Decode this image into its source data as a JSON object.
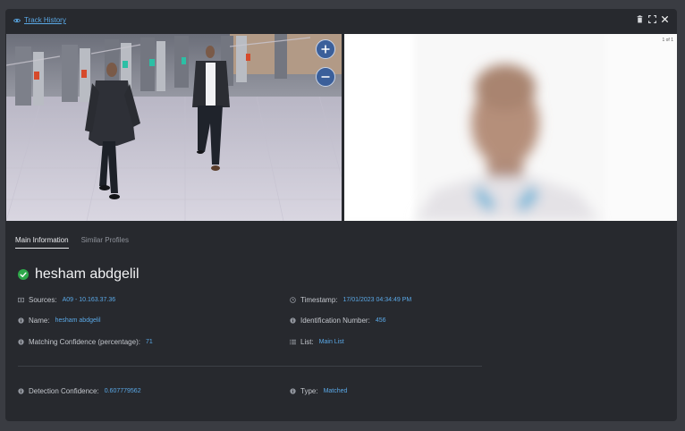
{
  "header": {
    "track_history_label": "Track History"
  },
  "viewer": {
    "pager_text": "1 of 1"
  },
  "tabs": [
    {
      "label": "Main Information",
      "active": true
    },
    {
      "label": "Similar Profiles",
      "active": false
    }
  ],
  "person": {
    "name": "hesham abdgelil",
    "status": "matched-check-icon"
  },
  "fields": {
    "sources": {
      "label": "Sources:",
      "value": "A09 - 10.163.37.36"
    },
    "timestamp": {
      "label": "Timestamp:",
      "value": "17/01/2023 04:34:49 PM"
    },
    "name": {
      "label": "Name:",
      "value": "hesham abdgelil"
    },
    "identification_number": {
      "label": "Identification Number:",
      "value": "456"
    },
    "matching_confidence": {
      "label": "Matching Confidence (percentage):",
      "value": "71"
    },
    "list": {
      "label": "List:",
      "value": "Main List"
    },
    "detection_confidence": {
      "label": "Detection Confidence:",
      "value": "0.607779562"
    },
    "type": {
      "label": "Type:",
      "value": "Matched"
    }
  },
  "colors": {
    "accent": "#5aa8e6",
    "panel_bg": "#27292e",
    "success": "#2ea84a",
    "zoom_button": "#3b5f9a"
  }
}
